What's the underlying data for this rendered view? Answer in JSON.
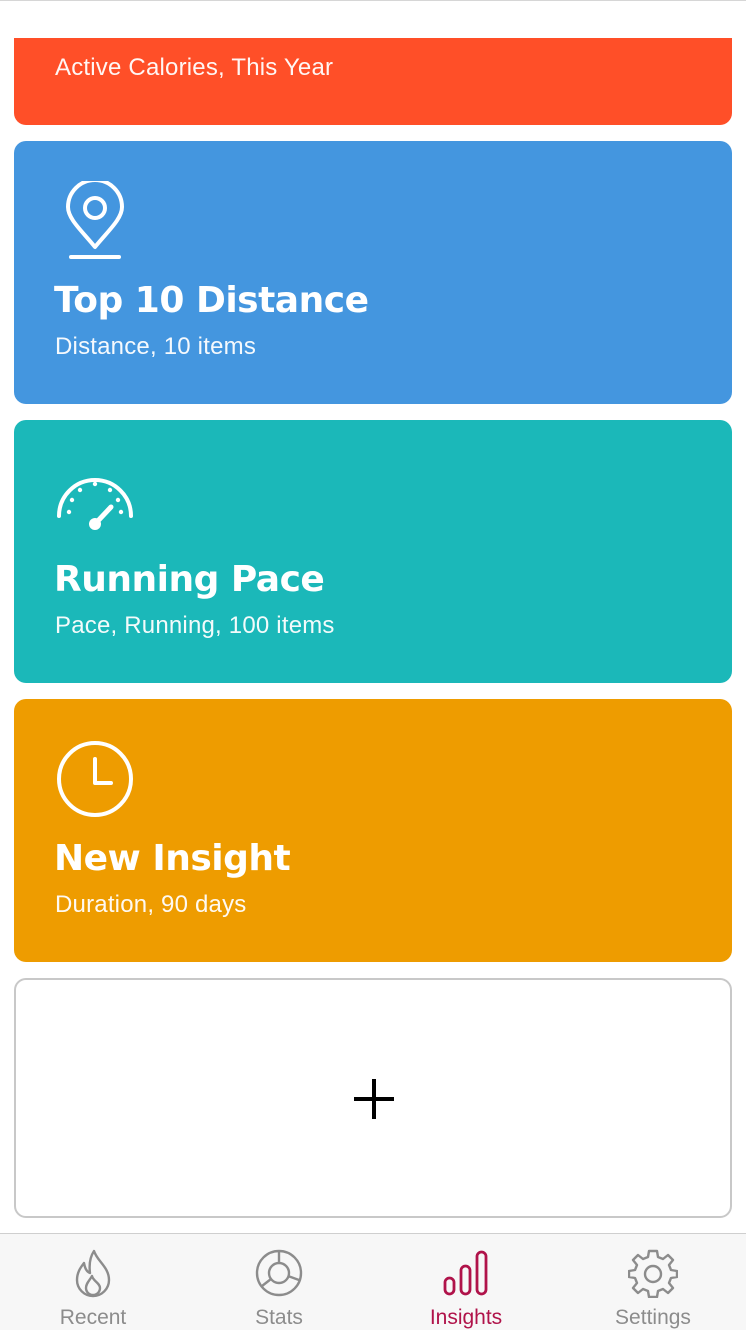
{
  "colors": {
    "calories_card": "#ff4f28",
    "distance_card": "#4496df",
    "pace_card": "#1bb8b9",
    "duration_card": "#ee9c00",
    "active_tab": "#b0134a",
    "inactive_tab": "#8c8c8c"
  },
  "cards": [
    {
      "icon": "flame-icon",
      "title": "",
      "subtitle": "Active Calories, This Year"
    },
    {
      "icon": "location-pin-icon",
      "title": "Top 10 Distance",
      "subtitle": "Distance, 10 items"
    },
    {
      "icon": "speedometer-icon",
      "title": "Running Pace",
      "subtitle": "Pace, Running, 100 items"
    },
    {
      "icon": "clock-icon",
      "title": "New Insight",
      "subtitle": "Duration, 90 days"
    }
  ],
  "add_card": {
    "icon": "plus-icon"
  },
  "tab_bar": {
    "active_index": 2,
    "items": [
      {
        "label": "Recent",
        "icon": "flame-icon"
      },
      {
        "label": "Stats",
        "icon": "stats-icon"
      },
      {
        "label": "Insights",
        "icon": "bar-chart-icon"
      },
      {
        "label": "Settings",
        "icon": "gear-icon"
      }
    ]
  }
}
